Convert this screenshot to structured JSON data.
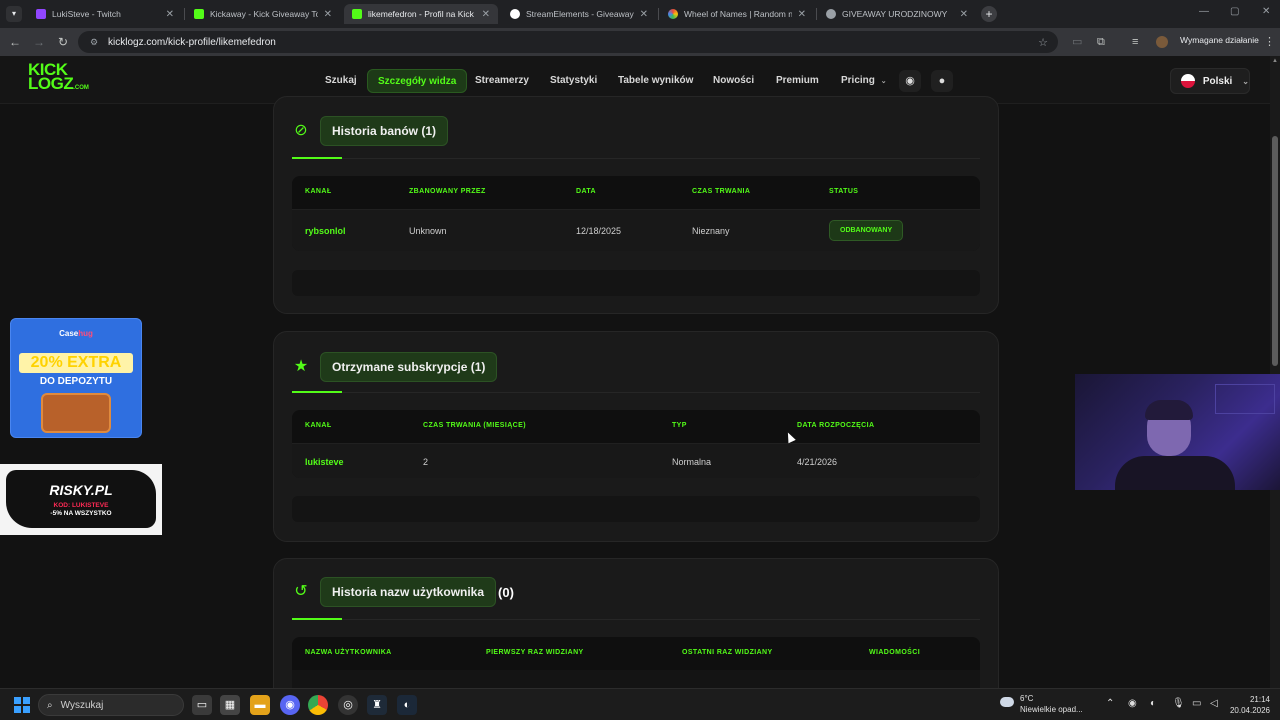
{
  "browser": {
    "tabs": [
      {
        "label": "LukiSteve - Twitch",
        "icon_color": "#9146ff"
      },
      {
        "label": "Kickaway - Kick Giveaway Tool",
        "icon_color": "#53fc18"
      },
      {
        "label": "likemefedron - Profil na Kick",
        "icon_color": "#53fc18"
      },
      {
        "label": "StreamElements - Giveaways",
        "icon_color": "#ffffff"
      },
      {
        "label": "Wheel of Names | Random nam",
        "icon_color": "#e94b3c"
      },
      {
        "label": "GIVEAWAY URODZINOWY",
        "icon_color": "#9aa0a6"
      }
    ],
    "active_tab": 2,
    "url": "kicklogz.com/kick-profile/likemefedron",
    "profile_notice": "Wymagane działanie"
  },
  "site": {
    "logo_line1": "KICK",
    "logo_line2": "LOGZ",
    "logo_suffix": ".COM",
    "nav": [
      "Szukaj",
      "Szczegóły widza",
      "Streamerzy",
      "Statystyki",
      "Tabele wyników",
      "Nowości",
      "Premium",
      "Pricing"
    ],
    "active_nav": "Szczegóły widza",
    "language": "Polski"
  },
  "bans": {
    "title": "Historia banów (1)",
    "columns": [
      "KANAŁ",
      "ZBANOWANY PRZEZ",
      "DATA",
      "CZAS TRWANIA",
      "STATUS"
    ],
    "rows": [
      {
        "channel": "rybsonlol",
        "banned_by": "Unknown",
        "date": "12/18/2025",
        "duration": "Nieznany",
        "status": "ODBANOWANY"
      }
    ]
  },
  "subs": {
    "title": "Otrzymane subskrypcje (1)",
    "columns": [
      "KANAŁ",
      "CZAS TRWANIA (MIESIĄCE)",
      "TYP",
      "DATA ROZPOCZĘCIA"
    ],
    "rows": [
      {
        "channel": "lukisteve",
        "months": "2",
        "type": "Normalna",
        "start": "4/21/2026"
      }
    ]
  },
  "names": {
    "title": "Historia nazw użytkownika",
    "count": "(0)",
    "columns": [
      "NAZWA UŻYTKOWNIKA",
      "PIERWSZY RAZ WIDZIANY",
      "OSTATNI RAZ WIDZIANY",
      "WIADOMOŚCI"
    ]
  },
  "ads": {
    "case_brand": "Case",
    "case_brand_accent": "hug",
    "case_promo": "20% EXTRA",
    "case_promo2": "DO DEPOZYTU",
    "risky_title": "RISKY.PL",
    "risky_code": "KOD: LUKISTEVE",
    "risky_offer": "-5% NA WSZYSTKO"
  },
  "taskbar": {
    "search_placeholder": "Wyszukaj",
    "weather_temp": "6°C",
    "weather_desc": "Niewielkie opad...",
    "time": "21:14",
    "date": "20.04.2026"
  },
  "colors": {
    "accent": "#53fc18",
    "background": "#121212",
    "card": "#1a1a1a"
  }
}
